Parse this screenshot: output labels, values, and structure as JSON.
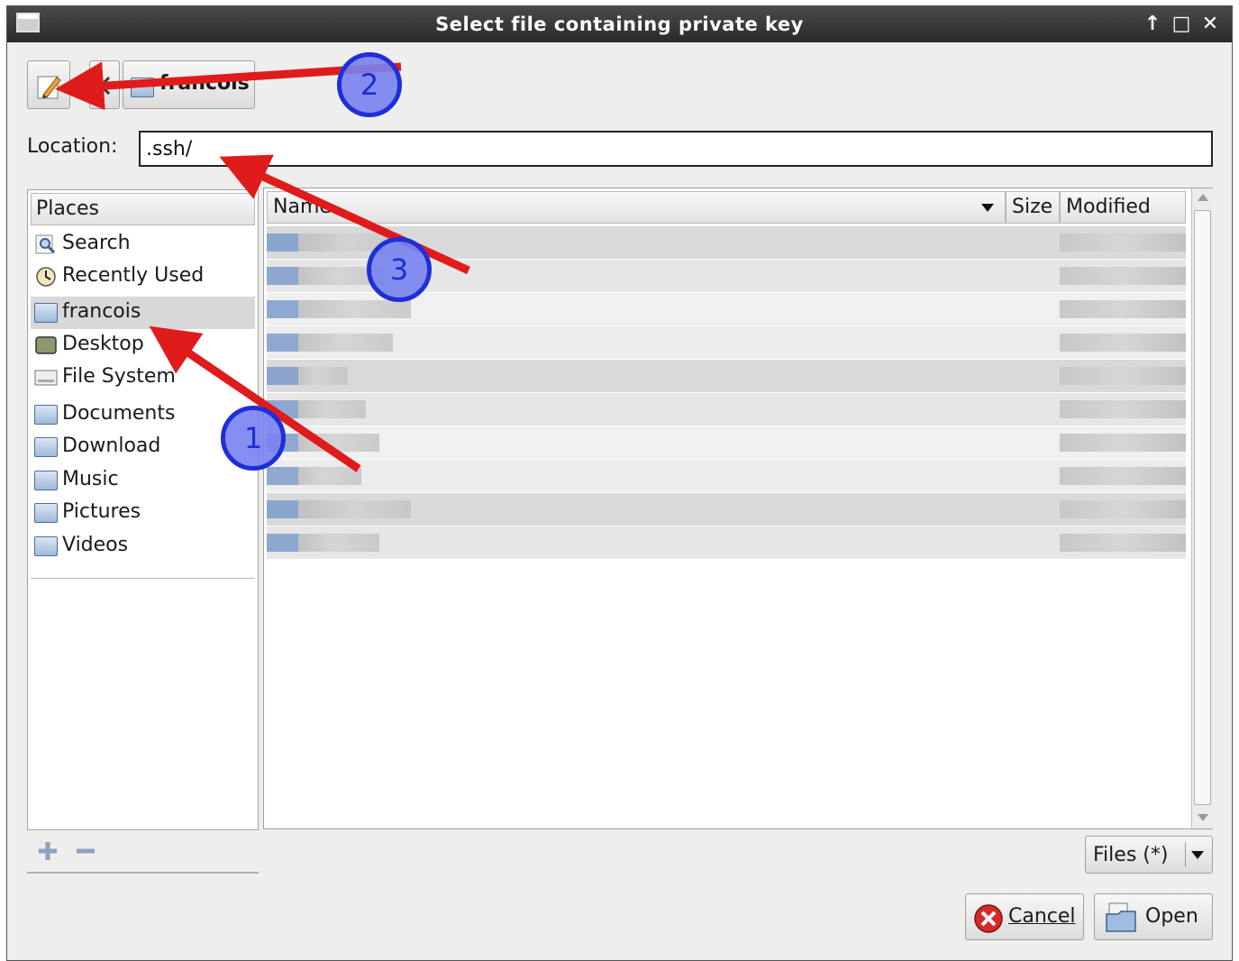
{
  "window": {
    "title": "Select file containing private key",
    "wm_buttons": [
      "↑",
      "□",
      "✕"
    ]
  },
  "toolbar": {
    "path_button_label": "francois"
  },
  "location": {
    "label": "Location:",
    "value": ".ssh/"
  },
  "places": {
    "header": "Places",
    "items": [
      {
        "label": "Search",
        "icon": "search-icon"
      },
      {
        "label": "Recently Used",
        "icon": "clock-icon"
      },
      {
        "label": "francois",
        "icon": "home-folder-icon",
        "selected": true
      },
      {
        "label": "Desktop",
        "icon": "desktop-icon"
      },
      {
        "label": "File System",
        "icon": "drive-icon"
      }
    ],
    "bookmarks": [
      {
        "label": "Documents",
        "icon": "folder-icon"
      },
      {
        "label": "Download",
        "icon": "folder-icon"
      },
      {
        "label": "Music",
        "icon": "folder-icon"
      },
      {
        "label": "Pictures",
        "icon": "folder-icon"
      },
      {
        "label": "Videos",
        "icon": "folder-icon"
      }
    ]
  },
  "files": {
    "columns": {
      "name": "Name",
      "size": "Size",
      "modified": "Modified"
    },
    "rows_count_note": ""
  },
  "filter": {
    "selected": "Files (*)"
  },
  "buttons": {
    "cancel": "Cancel",
    "open": "Open"
  },
  "annotations": {
    "callouts": [
      "1",
      "2",
      "3"
    ],
    "arrow_color": "#e01b1b",
    "callout_color": "#1f2fd6"
  }
}
